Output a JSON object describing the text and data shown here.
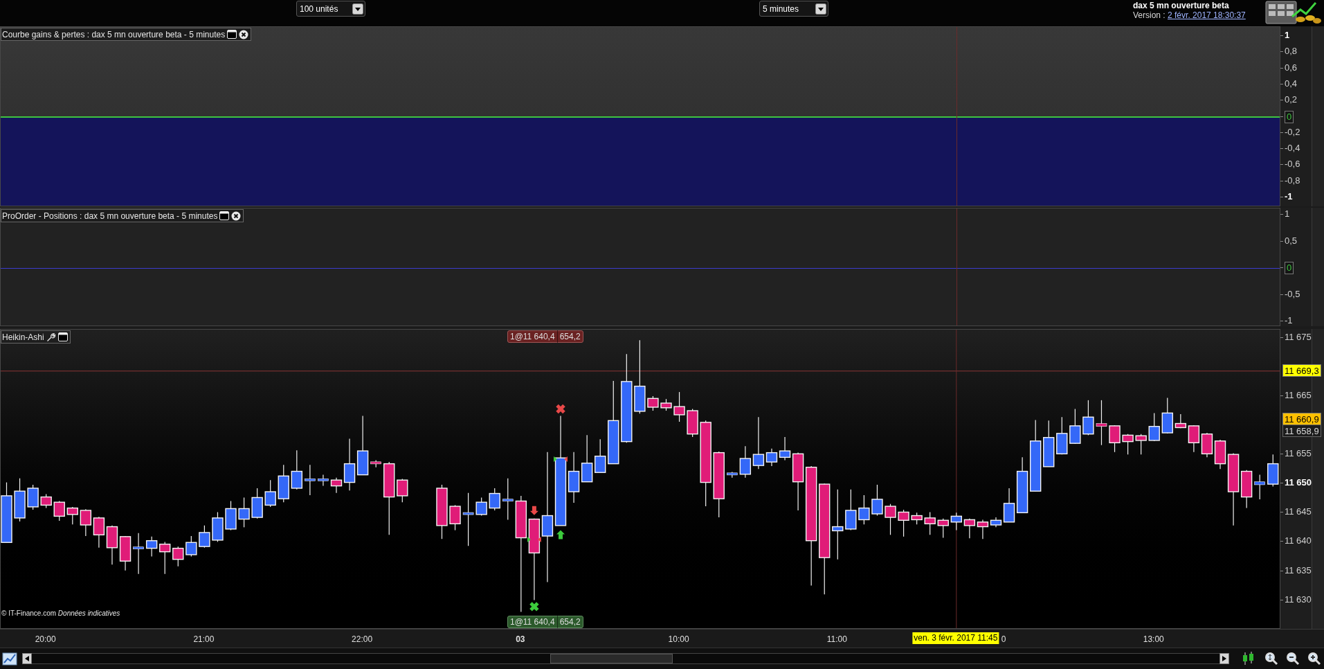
{
  "toolbar": {
    "quantity": "100 unités",
    "timeframe": "5 minutes",
    "title": "dax 5 mn ouverture beta",
    "version_label": "Version : ",
    "version_date": "2 févr. 2017 18:30:37"
  },
  "panels": [
    {
      "kind": "equity",
      "title": "Courbe gains & pertes : dax 5 mn ouverture beta - 5 minutes",
      "axis": [
        {
          "label": "1",
          "kind": "label",
          "bold": true
        },
        {
          "label": "0,8",
          "kind": "label",
          "bold": false
        },
        {
          "label": "0,6",
          "kind": "label",
          "bold": false
        },
        {
          "label": "0,4",
          "kind": "label",
          "bold": false
        },
        {
          "label": "0,2",
          "kind": "label",
          "bold": false
        },
        {
          "label": "0",
          "kind": "zero",
          "bold": false
        },
        {
          "label": "-0,2",
          "kind": "label",
          "bold": false
        },
        {
          "label": "-0,4",
          "kind": "label",
          "bold": false
        },
        {
          "label": "-0,6",
          "kind": "label",
          "bold": false
        },
        {
          "label": "-0,8",
          "kind": "label",
          "bold": false
        },
        {
          "label": "-1",
          "kind": "label",
          "bold": true
        }
      ]
    },
    {
      "kind": "positions",
      "title": "ProOrder - Positions : dax 5 mn ouverture beta - 5 minutes",
      "axis": [
        {
          "label": "1",
          "kind": "label",
          "bold": false
        },
        {
          "label": "0,5",
          "kind": "label",
          "bold": false
        },
        {
          "label": "0",
          "kind": "zero",
          "bold": false
        },
        {
          "label": "-0,5",
          "kind": "label",
          "bold": false
        },
        {
          "label": "-1",
          "kind": "label",
          "bold": false
        }
      ]
    }
  ],
  "price_panel": {
    "credit": "© IT-Finance.com *Données indicatives*",
    "partial_time_label": "0",
    "crosshair_label": "ven. 3 févr. 2017 11:45",
    "position_tags": [
      {
        "kind": "top",
        "labels": [
          "1@11 640,4",
          "654,2"
        ],
        "color": "#6a2222"
      },
      {
        "kind": "bottom",
        "labels": [
          "1@11 640,4",
          "654,2"
        ],
        "color": "#2c5a2c"
      }
    ],
    "chart_data": {
      "type": "candlestick",
      "title": "Heikin-Ashi",
      "categories": [
        null,
        null,
        null,
        "20:00",
        null,
        null,
        null,
        null,
        null,
        null,
        null,
        null,
        null,
        null,
        null,
        "21:00",
        null,
        null,
        null,
        null,
        null,
        null,
        null,
        null,
        null,
        null,
        null,
        "22:00",
        null,
        null,
        null,
        null,
        null,
        null,
        null,
        null,
        null,
        null,
        null,
        "03",
        null,
        null,
        null,
        null,
        null,
        null,
        null,
        null,
        null,
        null,
        null,
        "10:00",
        null,
        null,
        null,
        null,
        null,
        null,
        null,
        null,
        null,
        null,
        null,
        "11:00",
        null,
        null,
        null,
        null,
        null,
        null,
        null,
        null,
        null,
        null,
        null,
        null,
        null,
        null,
        null,
        null,
        null,
        null,
        null,
        null,
        null,
        null,
        null,
        "13:00",
        null,
        null,
        null,
        null,
        null,
        null,
        null,
        null,
        null
      ],
      "ohlc": [
        [
          11639.9,
          11650.2,
          11639.9,
          11647.9
        ],
        [
          11644.1,
          11650.9,
          11643.5,
          11648.7
        ],
        [
          11646.0,
          11649.8,
          11645.5,
          11649.2
        ],
        [
          11647.7,
          11648.2,
          11645.8,
          11646.3
        ],
        [
          11646.8,
          11647.0,
          11643.6,
          11644.4
        ],
        [
          11645.8,
          11646.0,
          11643.0,
          11644.7
        ],
        [
          11645.4,
          11645.6,
          11641.0,
          11642.9
        ],
        [
          11644.1,
          11644.3,
          11639.0,
          11641.2
        ],
        [
          11642.6,
          11642.8,
          11636.1,
          11639.0
        ],
        [
          11640.9,
          11641.0,
          11635.1,
          11636.7
        ],
        [
          11638.9,
          11641.5,
          11634.5,
          11639.0
        ],
        [
          11638.9,
          11640.9,
          11637.5,
          11640.2
        ],
        [
          11639.6,
          11640.0,
          11634.5,
          11638.3
        ],
        [
          11638.9,
          11639.2,
          11635.8,
          11637.0
        ],
        [
          11637.8,
          11641.0,
          11637.5,
          11639.9
        ],
        [
          11639.2,
          11642.8,
          11639.0,
          11641.6
        ],
        [
          11640.3,
          11645.1,
          11640.0,
          11644.1
        ],
        [
          11642.2,
          11647.0,
          11642.0,
          11645.7
        ],
        [
          11643.9,
          11647.6,
          11642.5,
          11645.7
        ],
        [
          11644.2,
          11649.2,
          11644.0,
          11647.6
        ],
        [
          11646.3,
          11650.6,
          11646.0,
          11648.6
        ],
        [
          11647.4,
          11653.2,
          11646.8,
          11651.3
        ],
        [
          11649.2,
          11655.7,
          11649.0,
          11652.1
        ],
        [
          11650.6,
          11653.2,
          11648.0,
          11650.7
        ],
        [
          11650.6,
          11651.5,
          11649.6,
          11650.7
        ],
        [
          11650.6,
          11651.0,
          11648.4,
          11649.6
        ],
        [
          11650.2,
          11657.7,
          11648.8,
          11653.4
        ],
        [
          11651.5,
          11661.6,
          11651.5,
          11655.6
        ],
        [
          11653.7,
          11654.0,
          11652.8,
          11653.4
        ],
        [
          11653.4,
          11653.7,
          11641.2,
          11647.7
        ],
        [
          11650.6,
          11650.8,
          11646.8,
          11647.9
        ],
        null,
        null,
        [
          11649.2,
          11649.8,
          11640.5,
          11642.8
        ],
        [
          11646.1,
          11646.3,
          11642.0,
          11643.1
        ],
        [
          11644.8,
          11648.4,
          11639.3,
          11644.9
        ],
        [
          11644.7,
          11647.6,
          11644.5,
          11646.8
        ],
        [
          11645.8,
          11649.2,
          11645.4,
          11648.3
        ],
        [
          11647.0,
          11650.9,
          11643.8,
          11647.3
        ],
        [
          11647.0,
          11647.9,
          11628.0,
          11640.7
        ],
        [
          11643.9,
          11644.0,
          11630.0,
          11638.1
        ],
        [
          11641.0,
          11655.4,
          11633.1,
          11644.5
        ],
        [
          11642.8,
          11661.6,
          11642.8,
          11654.4
        ],
        [
          11648.6,
          11655.4,
          11646.7,
          11652.1
        ],
        [
          11650.3,
          11658.3,
          11650.3,
          11653.5
        ],
        [
          11651.9,
          11657.6,
          11651.9,
          11654.7
        ],
        [
          11653.4,
          11667.6,
          11653.4,
          11660.8
        ],
        [
          11657.2,
          11672.2,
          11657.0,
          11667.5
        ],
        [
          11662.4,
          11674.6,
          11662.0,
          11666.7
        ],
        [
          11664.6,
          11665.0,
          11662.5,
          11663.1
        ],
        [
          11663.8,
          11664.5,
          11662.5,
          11663.0
        ],
        [
          11663.2,
          11665.7,
          11660.6,
          11661.8
        ],
        [
          11662.5,
          11662.8,
          11658.0,
          11658.5
        ],
        [
          11660.5,
          11660.8,
          11646.1,
          11650.2
        ],
        [
          11655.3,
          11655.5,
          11644.2,
          11647.4
        ],
        [
          11651.5,
          11652.0,
          11651.0,
          11651.8
        ],
        [
          11651.6,
          11656.4,
          11651.0,
          11654.3
        ],
        [
          11653.1,
          11661.4,
          11652.5,
          11655.0
        ],
        [
          11653.7,
          11656.0,
          11653.0,
          11655.3
        ],
        [
          11654.5,
          11658.0,
          11654.0,
          11655.6
        ],
        [
          11655.1,
          11655.3,
          11645.4,
          11650.3
        ],
        [
          11652.8,
          11653.0,
          11632.5,
          11640.2
        ],
        [
          11649.9,
          11650.0,
          11631.0,
          11637.3
        ],
        [
          11641.9,
          11649.0,
          11637.0,
          11642.6
        ],
        [
          11642.2,
          11649.0,
          11642.0,
          11645.4
        ],
        [
          11643.8,
          11648.0,
          11643.0,
          11645.8
        ],
        [
          11644.8,
          11649.8,
          11644.5,
          11647.3
        ],
        [
          11646.1,
          11646.5,
          11641.2,
          11644.2
        ],
        [
          11645.1,
          11645.5,
          11640.9,
          11643.7
        ],
        [
          11644.5,
          11645.0,
          11643.0,
          11643.8
        ],
        [
          11644.1,
          11645.1,
          11641.2,
          11643.1
        ],
        [
          11643.7,
          11644.0,
          11640.7,
          11642.8
        ],
        [
          11643.4,
          11645.0,
          11642.0,
          11644.4
        ],
        [
          11643.8,
          11644.0,
          11640.6,
          11642.8
        ],
        [
          11643.4,
          11643.8,
          11640.5,
          11642.6
        ],
        [
          11642.9,
          11644.2,
          11642.5,
          11643.7
        ],
        [
          11643.4,
          11649.2,
          11643.4,
          11646.6
        ],
        [
          11645.0,
          11654.5,
          11645.0,
          11652.1
        ],
        [
          11648.7,
          11660.9,
          11648.7,
          11657.3
        ],
        [
          11652.9,
          11660.8,
          11652.9,
          11657.9
        ],
        [
          11655.1,
          11661.4,
          11655.0,
          11658.6
        ],
        [
          11656.9,
          11662.8,
          11656.8,
          11659.9
        ],
        [
          11658.5,
          11664.3,
          11658.3,
          11661.4
        ],
        [
          11660.3,
          11664.3,
          11656.6,
          11659.8
        ],
        [
          11659.9,
          11660.0,
          11655.4,
          11657.0
        ],
        [
          11658.3,
          11658.5,
          11655.0,
          11657.2
        ],
        [
          11658.2,
          11658.5,
          11655.0,
          11657.4
        ],
        [
          11657.4,
          11662.1,
          11657.3,
          11659.8
        ],
        [
          11658.7,
          11664.7,
          11658.6,
          11662.1
        ],
        [
          11660.3,
          11661.9,
          11659.5,
          11659.6
        ],
        [
          11659.9,
          11660.0,
          11655.4,
          11657.0
        ],
        [
          11658.5,
          11658.7,
          11654.5,
          11655.1
        ],
        [
          11657.3,
          11657.5,
          11652.5,
          11653.4
        ],
        [
          11655.0,
          11655.2,
          11642.8,
          11648.6
        ],
        [
          11652.1,
          11652.3,
          11645.8,
          11647.7
        ],
        [
          11649.8,
          11651.5,
          11647.3,
          11650.3
        ],
        [
          11649.9,
          11655.0,
          11649.5,
          11653.4
        ]
      ],
      "ylim": [
        11625.2,
        11676.4
      ],
      "yticks": [
        {
          "value": 11675,
          "label": "11 675"
        },
        {
          "value": 11665,
          "label": "11 665"
        },
        {
          "value": 11655,
          "label": "11 655"
        },
        {
          "value": 11650,
          "label": "11 650"
        },
        {
          "value": 11645,
          "label": "11 645"
        },
        {
          "value": 11640,
          "label": "11 640"
        },
        {
          "value": 11635,
          "label": "11 635"
        },
        {
          "value": 11630,
          "label": "11 630"
        }
      ],
      "ref_lines": [
        {
          "axis": "y",
          "value": 11669.3,
          "label": "11 669,3"
        }
      ],
      "annotations": [
        "11 660,9",
        "11 658,9"
      ]
    }
  }
}
